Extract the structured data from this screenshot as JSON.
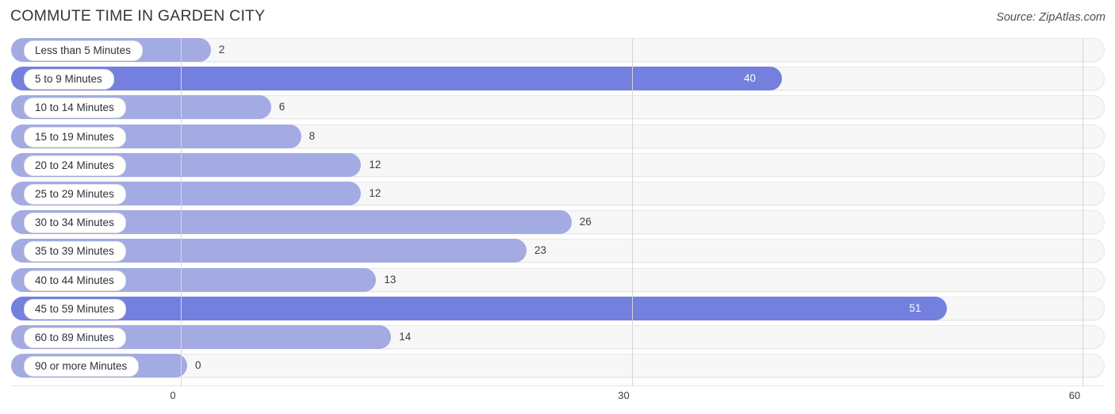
{
  "header": {
    "title": "COMMUTE TIME IN GARDEN CITY",
    "source": "Source: ZipAtlas.com"
  },
  "axis": {
    "ticks": [
      "0",
      "30",
      "60"
    ]
  },
  "colors": {
    "bar_light": "#a3abe2",
    "bar_strong": "#7380de",
    "track": "#f7f7f8",
    "gridline": "#d5d5d8",
    "label_text": "#2e3138",
    "value_in_text": "#ffffff"
  },
  "chart_data": {
    "type": "bar",
    "orientation": "horizontal",
    "title": "COMMUTE TIME IN GARDEN CITY",
    "subtitle": "",
    "xlabel": "",
    "ylabel": "",
    "xlim": [
      0,
      60
    ],
    "xticks": [
      0,
      30,
      60
    ],
    "grid": true,
    "legend": "none",
    "source": "Source: ZipAtlas.com",
    "categories": [
      "Less than 5 Minutes",
      "5 to 9 Minutes",
      "10 to 14 Minutes",
      "15 to 19 Minutes",
      "20 to 24 Minutes",
      "25 to 29 Minutes",
      "30 to 34 Minutes",
      "35 to 39 Minutes",
      "40 to 44 Minutes",
      "45 to 59 Minutes",
      "60 to 89 Minutes",
      "90 or more Minutes"
    ],
    "values": [
      2,
      40,
      6,
      8,
      12,
      12,
      26,
      23,
      13,
      51,
      14,
      0
    ],
    "rows": [
      {
        "label": "Less than 5 Minutes",
        "value": 2,
        "value_label": "2",
        "highlight": false,
        "label_inside": false
      },
      {
        "label": "5 to 9 Minutes",
        "value": 40,
        "value_label": "40",
        "highlight": true,
        "label_inside": true
      },
      {
        "label": "10 to 14 Minutes",
        "value": 6,
        "value_label": "6",
        "highlight": false,
        "label_inside": false
      },
      {
        "label": "15 to 19 Minutes",
        "value": 8,
        "value_label": "8",
        "highlight": false,
        "label_inside": false
      },
      {
        "label": "20 to 24 Minutes",
        "value": 12,
        "value_label": "12",
        "highlight": false,
        "label_inside": false
      },
      {
        "label": "25 to 29 Minutes",
        "value": 12,
        "value_label": "12",
        "highlight": false,
        "label_inside": false
      },
      {
        "label": "30 to 34 Minutes",
        "value": 26,
        "value_label": "26",
        "highlight": false,
        "label_inside": false
      },
      {
        "label": "35 to 39 Minutes",
        "value": 23,
        "value_label": "23",
        "highlight": false,
        "label_inside": false
      },
      {
        "label": "40 to 44 Minutes",
        "value": 13,
        "value_label": "13",
        "highlight": false,
        "label_inside": false
      },
      {
        "label": "45 to 59 Minutes",
        "value": 51,
        "value_label": "51",
        "highlight": true,
        "label_inside": true
      },
      {
        "label": "60 to 89 Minutes",
        "value": 14,
        "value_label": "14",
        "highlight": false,
        "label_inside": false
      },
      {
        "label": "90 or more Minutes",
        "value": 0,
        "value_label": "0",
        "highlight": false,
        "label_inside": false
      }
    ]
  }
}
